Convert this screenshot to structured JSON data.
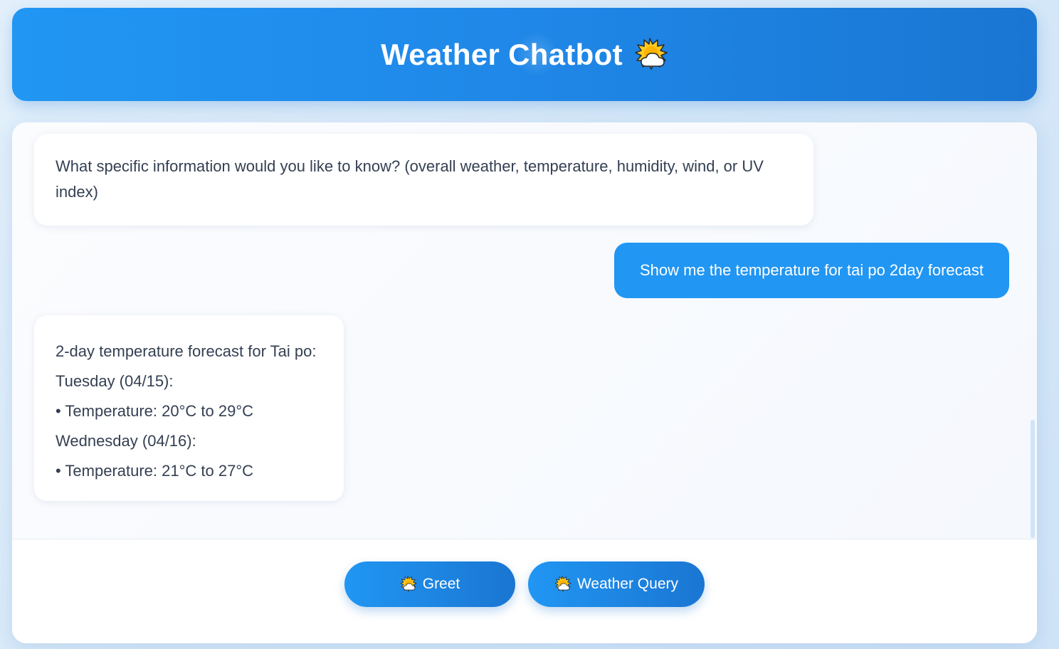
{
  "header": {
    "title": "Weather Chatbot",
    "title_icon": "sun-behind-cloud-icon"
  },
  "messages": [
    {
      "role": "bot",
      "lines": [
        "What specific information would you like to know? (overall weather, temperature, humidity, wind, or UV index)"
      ]
    },
    {
      "role": "user",
      "text": "Show me the temperature for tai po 2day forecast"
    },
    {
      "role": "bot",
      "lines": [
        "2-day temperature forecast for Tai po:",
        "Tuesday (04/15):",
        "• Temperature: 20°C to 29°C",
        "Wednesday (04/16):",
        "• Temperature: 21°C to 27°C"
      ]
    }
  ],
  "actions": {
    "greet_label": "Greet",
    "weather_query_label": "Weather Query",
    "icon": "sun-behind-cloud-icon"
  },
  "colors": {
    "accent": "#2196f3",
    "accent_dark": "#1a76d2",
    "bot_text": "#344052",
    "page_background": "#d6e8f8"
  }
}
